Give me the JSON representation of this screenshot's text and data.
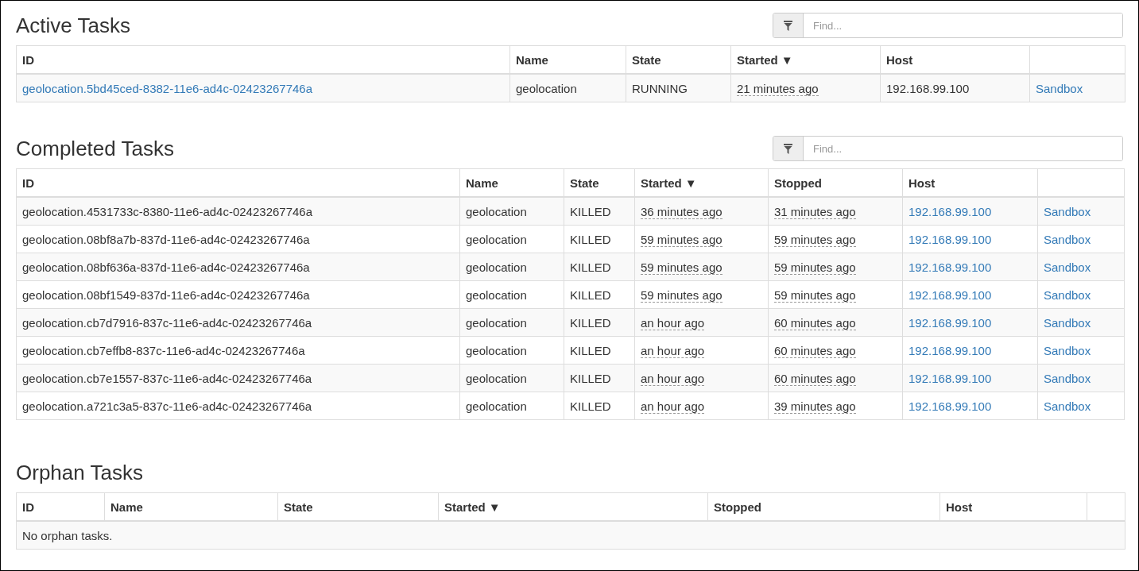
{
  "sections": [
    {
      "title": "Active Tasks",
      "search": {
        "placeholder": "Find..."
      },
      "columns": [
        "ID",
        "Name",
        "State",
        "Started ▼",
        "Host"
      ],
      "rows": [
        [
          {
            "kind": "link",
            "text": "geolocation.5bd45ced-8382-11e6-ad4c-02423267746a"
          },
          {
            "kind": "text",
            "text": "geolocation"
          },
          {
            "kind": "text",
            "text": "RUNNING"
          },
          {
            "kind": "time",
            "text": "21 minutes ago"
          },
          {
            "kind": "text",
            "text": "192.168.99.100"
          },
          {
            "kind": "link",
            "text": "Sandbox"
          }
        ]
      ]
    },
    {
      "title": "Completed Tasks",
      "search": {
        "placeholder": "Find..."
      },
      "columns": [
        "ID",
        "Name",
        "State",
        "Started ▼",
        "Stopped",
        "Host"
      ],
      "rows": [
        [
          {
            "kind": "text",
            "text": "geolocation.4531733c-8380-11e6-ad4c-02423267746a"
          },
          {
            "kind": "text",
            "text": "geolocation"
          },
          {
            "kind": "text",
            "text": "KILLED"
          },
          {
            "kind": "time",
            "text": "36 minutes ago"
          },
          {
            "kind": "time",
            "text": "31 minutes ago"
          },
          {
            "kind": "link",
            "text": "192.168.99.100"
          },
          {
            "kind": "link",
            "text": "Sandbox"
          }
        ],
        [
          {
            "kind": "text",
            "text": "geolocation.08bf8a7b-837d-11e6-ad4c-02423267746a"
          },
          {
            "kind": "text",
            "text": "geolocation"
          },
          {
            "kind": "text",
            "text": "KILLED"
          },
          {
            "kind": "time",
            "text": "59 minutes ago"
          },
          {
            "kind": "time",
            "text": "59 minutes ago"
          },
          {
            "kind": "link",
            "text": "192.168.99.100"
          },
          {
            "kind": "link",
            "text": "Sandbox"
          }
        ],
        [
          {
            "kind": "text",
            "text": "geolocation.08bf636a-837d-11e6-ad4c-02423267746a"
          },
          {
            "kind": "text",
            "text": "geolocation"
          },
          {
            "kind": "text",
            "text": "KILLED"
          },
          {
            "kind": "time",
            "text": "59 minutes ago"
          },
          {
            "kind": "time",
            "text": "59 minutes ago"
          },
          {
            "kind": "link",
            "text": "192.168.99.100"
          },
          {
            "kind": "link",
            "text": "Sandbox"
          }
        ],
        [
          {
            "kind": "text",
            "text": "geolocation.08bf1549-837d-11e6-ad4c-02423267746a"
          },
          {
            "kind": "text",
            "text": "geolocation"
          },
          {
            "kind": "text",
            "text": "KILLED"
          },
          {
            "kind": "time",
            "text": "59 minutes ago"
          },
          {
            "kind": "time",
            "text": "59 minutes ago"
          },
          {
            "kind": "link",
            "text": "192.168.99.100"
          },
          {
            "kind": "link",
            "text": "Sandbox"
          }
        ],
        [
          {
            "kind": "text",
            "text": "geolocation.cb7d7916-837c-11e6-ad4c-02423267746a"
          },
          {
            "kind": "text",
            "text": "geolocation"
          },
          {
            "kind": "text",
            "text": "KILLED"
          },
          {
            "kind": "time",
            "text": "an hour ago"
          },
          {
            "kind": "time",
            "text": "60 minutes ago"
          },
          {
            "kind": "link",
            "text": "192.168.99.100"
          },
          {
            "kind": "link",
            "text": "Sandbox"
          }
        ],
        [
          {
            "kind": "text",
            "text": "geolocation.cb7effb8-837c-11e6-ad4c-02423267746a"
          },
          {
            "kind": "text",
            "text": "geolocation"
          },
          {
            "kind": "text",
            "text": "KILLED"
          },
          {
            "kind": "time",
            "text": "an hour ago"
          },
          {
            "kind": "time",
            "text": "60 minutes ago"
          },
          {
            "kind": "link",
            "text": "192.168.99.100"
          },
          {
            "kind": "link",
            "text": "Sandbox"
          }
        ],
        [
          {
            "kind": "text",
            "text": "geolocation.cb7e1557-837c-11e6-ad4c-02423267746a"
          },
          {
            "kind": "text",
            "text": "geolocation"
          },
          {
            "kind": "text",
            "text": "KILLED"
          },
          {
            "kind": "time",
            "text": "an hour ago"
          },
          {
            "kind": "time",
            "text": "60 minutes ago"
          },
          {
            "kind": "link",
            "text": "192.168.99.100"
          },
          {
            "kind": "link",
            "text": "Sandbox"
          }
        ],
        [
          {
            "kind": "text",
            "text": "geolocation.a721c3a5-837c-11e6-ad4c-02423267746a"
          },
          {
            "kind": "text",
            "text": "geolocation"
          },
          {
            "kind": "text",
            "text": "KILLED"
          },
          {
            "kind": "time",
            "text": "an hour ago"
          },
          {
            "kind": "time",
            "text": "39 minutes ago"
          },
          {
            "kind": "link",
            "text": "192.168.99.100"
          },
          {
            "kind": "link",
            "text": "Sandbox"
          }
        ]
      ]
    },
    {
      "title": "Orphan Tasks",
      "columns": [
        "ID",
        "Name",
        "State",
        "Started ▼",
        "Stopped",
        "Host"
      ],
      "empty_message": "No orphan tasks."
    }
  ]
}
